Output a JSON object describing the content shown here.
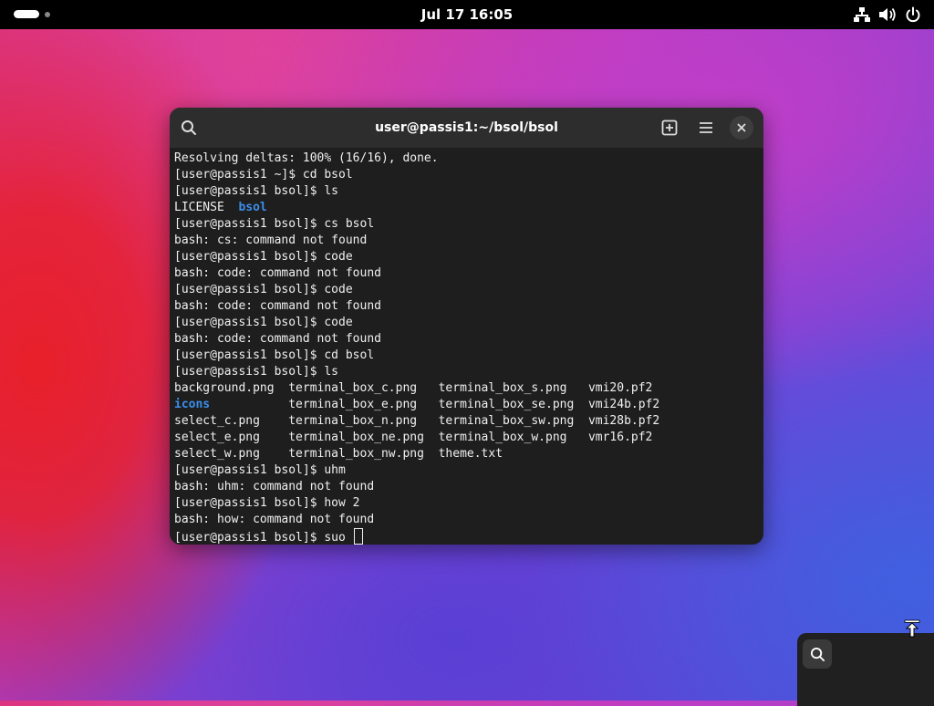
{
  "topbar": {
    "clock": "Jul 17  16:05",
    "icons": [
      "activities-indicator",
      "network-icon",
      "volume-icon",
      "power-icon"
    ]
  },
  "terminal": {
    "title": "user@passis1:~/bsol/bsol",
    "header_icons": [
      "search-icon",
      "new-tab-icon",
      "menu-icon",
      "close-icon"
    ],
    "lines": [
      [
        {
          "t": "Resolving deltas: 100% (16/16), done."
        }
      ],
      [
        {
          "t": "[user@passis1 ~]$ cd bsol"
        }
      ],
      [
        {
          "t": "[user@passis1 bsol]$ ls"
        }
      ],
      [
        {
          "t": "LICENSE  "
        },
        {
          "t": "bsol",
          "c": "dir"
        }
      ],
      [
        {
          "t": "[user@passis1 bsol]$ cs bsol"
        }
      ],
      [
        {
          "t": "bash: cs: command not found"
        }
      ],
      [
        {
          "t": "[user@passis1 bsol]$ code"
        }
      ],
      [
        {
          "t": "bash: code: command not found"
        }
      ],
      [
        {
          "t": "[user@passis1 bsol]$ code"
        }
      ],
      [
        {
          "t": "bash: code: command not found"
        }
      ],
      [
        {
          "t": "[user@passis1 bsol]$ code"
        }
      ],
      [
        {
          "t": "bash: code: command not found"
        }
      ],
      [
        {
          "t": "[user@passis1 bsol]$ cd bsol"
        }
      ],
      [
        {
          "t": "[user@passis1 bsol]$ ls"
        }
      ],
      [
        {
          "t": "background.png  terminal_box_c.png   terminal_box_s.png   vmi20.pf2"
        }
      ],
      [
        {
          "t": "icons",
          "c": "dir"
        },
        {
          "t": "           terminal_box_e.png   terminal_box_se.png  vmi24b.pf2"
        }
      ],
      [
        {
          "t": "select_c.png    terminal_box_n.png   terminal_box_sw.png  vmi28b.pf2"
        }
      ],
      [
        {
          "t": "select_e.png    terminal_box_ne.png  terminal_box_w.png   vmr16.pf2"
        }
      ],
      [
        {
          "t": "select_w.png    terminal_box_nw.png  theme.txt"
        }
      ],
      [
        {
          "t": "[user@passis1 bsol]$ uhm"
        }
      ],
      [
        {
          "t": "bash: uhm: command not found"
        }
      ],
      [
        {
          "t": "[user@passis1 bsol]$ how 2"
        }
      ],
      [
        {
          "t": "bash: how: command not found"
        }
      ]
    ],
    "prompt": "[user@passis1 bsol]$ suo "
  },
  "colors": {
    "dir": "#3b8eea",
    "terminal_bg": "#1e1e1e",
    "header_bg": "#2d2d2d"
  }
}
